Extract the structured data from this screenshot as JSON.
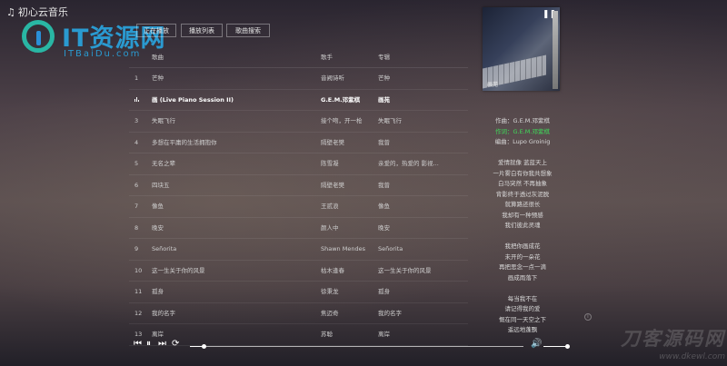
{
  "app": {
    "title": "初心云音乐",
    "icon": "music-note-icon"
  },
  "watermark_logo": {
    "text": "IT资源网",
    "subtext": "ITBaiDu.com"
  },
  "tabs": [
    {
      "label": "正在播放"
    },
    {
      "label": "播放列表"
    },
    {
      "label": "歌曲搜索"
    }
  ],
  "list": {
    "headers": {
      "title": "歌曲",
      "artist": "歌手",
      "album": "专辑"
    },
    "rows": [
      {
        "num": "1",
        "title": "芒种",
        "artist": "音阙诗听",
        "album": "芒种",
        "playing": false
      },
      {
        "num": "",
        "title": "画 (Live Piano Session II)",
        "artist": "G.E.M.邓紫棋",
        "album": "画苑",
        "playing": true
      },
      {
        "num": "3",
        "title": "失眠飞行",
        "artist": "接个吻，开一枪",
        "album": "失眠飞行",
        "playing": false
      },
      {
        "num": "4",
        "title": "多想在平庸的生活拥抱你",
        "artist": "隔壁老樊",
        "album": "我曾",
        "playing": false
      },
      {
        "num": "5",
        "title": "无名之辈",
        "artist": "陈雪凝",
        "album": "亲爱的，热爱的 影视...",
        "playing": false
      },
      {
        "num": "6",
        "title": "四块五",
        "artist": "隔壁老樊",
        "album": "我曾",
        "playing": false
      },
      {
        "num": "7",
        "title": "像鱼",
        "artist": "王贰浪",
        "album": "像鱼",
        "playing": false
      },
      {
        "num": "8",
        "title": "晚安",
        "artist": "颜人中",
        "album": "晚安",
        "playing": false
      },
      {
        "num": "9",
        "title": "Señorita",
        "artist": "Shawn Mendes",
        "album": "Señorita",
        "playing": false
      },
      {
        "num": "10",
        "title": "这一生关于你的风景",
        "artist": "枯木逢春",
        "album": "这一生关于你的风景",
        "playing": false
      },
      {
        "num": "11",
        "title": "孤身",
        "artist": "徐秉龙",
        "album": "孤身",
        "playing": false
      },
      {
        "num": "12",
        "title": "我的名字",
        "artist": "焦迈奇",
        "album": "我的名字",
        "playing": false
      },
      {
        "num": "13",
        "title": "离岸",
        "artist": "苏聪",
        "album": "离岸",
        "playing": false
      }
    ]
  },
  "cover": {
    "caption": "画苑"
  },
  "lyrics": [
    {
      "text": "作曲：G.E.M.邓紫棋",
      "active": false
    },
    {
      "text": "作词：G.E.M.邓紫棋",
      "active": true
    },
    {
      "text": "编曲：Lupo Groinig",
      "active": false
    },
    {
      "text": "",
      "active": false
    },
    {
      "text": "爱情就像 蓝蓝天上",
      "active": false
    },
    {
      "text": "一片雾白有你我共想象",
      "active": false
    },
    {
      "text": "白马突然 不再抽象",
      "active": false
    },
    {
      "text": "背影终于透过灰泥脱",
      "active": false
    },
    {
      "text": "就算路还很长",
      "active": false
    },
    {
      "text": "我却有一种预感",
      "active": false
    },
    {
      "text": "我们彼此灵魂",
      "active": false
    },
    {
      "text": "",
      "active": false
    },
    {
      "text": "我把你画成花",
      "active": false
    },
    {
      "text": "未开的一朵花",
      "active": false
    },
    {
      "text": "再把思念一点一滴",
      "active": false
    },
    {
      "text": "画成雨落下",
      "active": false
    },
    {
      "text": "",
      "active": false
    },
    {
      "text": "每当我不在",
      "active": false
    },
    {
      "text": "请记得我的爱",
      "active": false
    },
    {
      "text": "慨在同一天空之下",
      "active": false
    },
    {
      "text": "遥远地蓬飘",
      "active": false
    }
  ],
  "player": {
    "progress": 0.04,
    "volume": 0.92,
    "controls": {
      "prev": "skip-previous-icon",
      "pause": "pause-icon",
      "next": "skip-next-icon",
      "loop": "loop-icon",
      "volume": "volume-icon"
    }
  },
  "corner_watermark": {
    "big": "刀客源码网",
    "small": "www.dkewl.com"
  }
}
